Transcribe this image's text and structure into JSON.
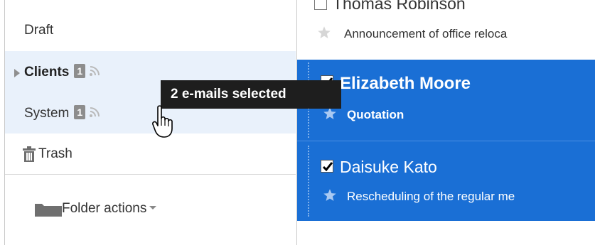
{
  "sidebar": {
    "folders": [
      {
        "label": "Draft"
      },
      {
        "label": "Clients",
        "badge": "1",
        "expandable": true
      },
      {
        "label": "System",
        "badge": "1"
      },
      {
        "label": "Trash"
      }
    ],
    "folder_actions_label": "Folder actions"
  },
  "messages": [
    {
      "sender": "Thomas Robinson",
      "subject": "Announcement of office reloca",
      "selected": false,
      "checked": false
    },
    {
      "sender": "Elizabeth Moore",
      "subject": "Quotation",
      "selected": true,
      "checked": true
    },
    {
      "sender": "Daisuke Kato",
      "subject": "Rescheduling of the regular me",
      "selected": true,
      "checked": true
    }
  ],
  "tooltip": {
    "text": "2 e-mails selected"
  },
  "colors": {
    "selection": "#1a6fd5",
    "sidebar_highlight": "#e9f1fb",
    "tooltip_bg": "#1e1e1e"
  },
  "icons": [
    "expander-triangle-icon",
    "rss-feed-icon",
    "trash-icon",
    "folder-icon",
    "star-icon",
    "checkbox-icon",
    "hand-pointer-icon"
  ]
}
